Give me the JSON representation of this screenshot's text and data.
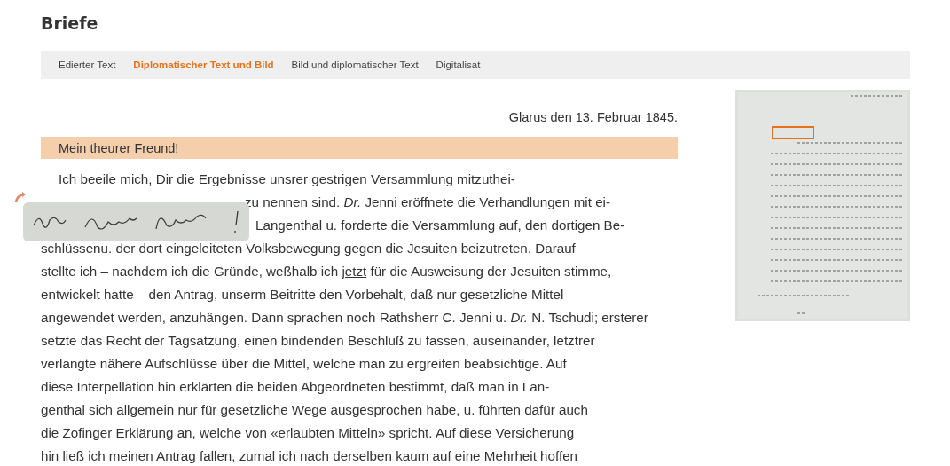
{
  "page_title": "Briefe",
  "tabs": [
    {
      "label": "Edierter Text",
      "selected": false
    },
    {
      "label": "Diplomatischer Text und Bild",
      "selected": true
    },
    {
      "label": "Bild und diplomatischer Text",
      "selected": false
    },
    {
      "label": "Digitalisat",
      "selected": false
    }
  ],
  "letter": {
    "date": "Glarus den 13. Februar 1845.",
    "salutation": "Mein theurer Freund!",
    "lines": [
      {
        "kind": "first",
        "segments": [
          {
            "text": "Ich beeile mich, Dir die Ergebnisse unsrer gestrigen Versammlung mitzuthei-"
          }
        ]
      },
      {
        "kind": "covered",
        "segments": [
          {
            "text": "zu nennen sind. *Dr.* Jenni eröffnete die Verhandlungen mit ei-"
          }
        ]
      },
      {
        "kind": "tail",
        "segments": [
          {
            "text": "Langenthal u. forderte die Versammlung auf, den dortigen Be-"
          }
        ]
      },
      {
        "kind": "plain",
        "segments": [
          {
            "text": "schlüssenu. der dort eingeleiteten Volksbewegung gegen die Jesuiten beizutreten. Darauf"
          }
        ]
      },
      {
        "kind": "plain",
        "segments": [
          {
            "text": "stellte ich – nachdem ich die Gründe, weßhalb ich "
          },
          {
            "text": "jetzt",
            "underlined": true
          },
          {
            "text": " für die Ausweisung der Jesuiten stimme,"
          }
        ]
      },
      {
        "kind": "plain",
        "segments": [
          {
            "text": "entwickelt hatte – den Antrag, unserm Beitritte den Vorbehalt, daß nur gesetzliche Mittel"
          }
        ]
      },
      {
        "kind": "plain",
        "segments": [
          {
            "text": "angewendet werden, anzuhängen. Dann sprachen noch Rathsherr C. Jenni u. *Dr.* N. Tschudi; ersterer"
          }
        ]
      },
      {
        "kind": "plain",
        "segments": [
          {
            "text": "setzte das Recht der Tagsatzung, einen bindenden Beschluß zu fassen, auseinander, letztrer"
          }
        ]
      },
      {
        "kind": "plain",
        "segments": [
          {
            "text": "verlangte nähere Aufschlüsse über die Mittel, welche man zu ergreifen beabsichtige. Auf"
          }
        ]
      },
      {
        "kind": "plain",
        "segments": [
          {
            "text": "diese Interpellation hin erklärten die beiden Abgeordneten bestimmt, daß man in Lan-"
          }
        ]
      },
      {
        "kind": "plain",
        "segments": [
          {
            "text": "genthal sich allgemein nur für gesetzliche Wege ausgesprochen habe, u. führten dafür auch"
          }
        ]
      },
      {
        "kind": "plain",
        "segments": [
          {
            "text": "die Zofinger Erklärung an, welche von «erlaubten Mitteln» spricht. Auf diese Versicherung"
          }
        ]
      },
      {
        "kind": "plain",
        "segments": [
          {
            "text": "hin ließ ich meinen Antrag fallen, zumal ich nach derselben kaum auf eine Mehrheit hoffen"
          }
        ]
      }
    ]
  }
}
